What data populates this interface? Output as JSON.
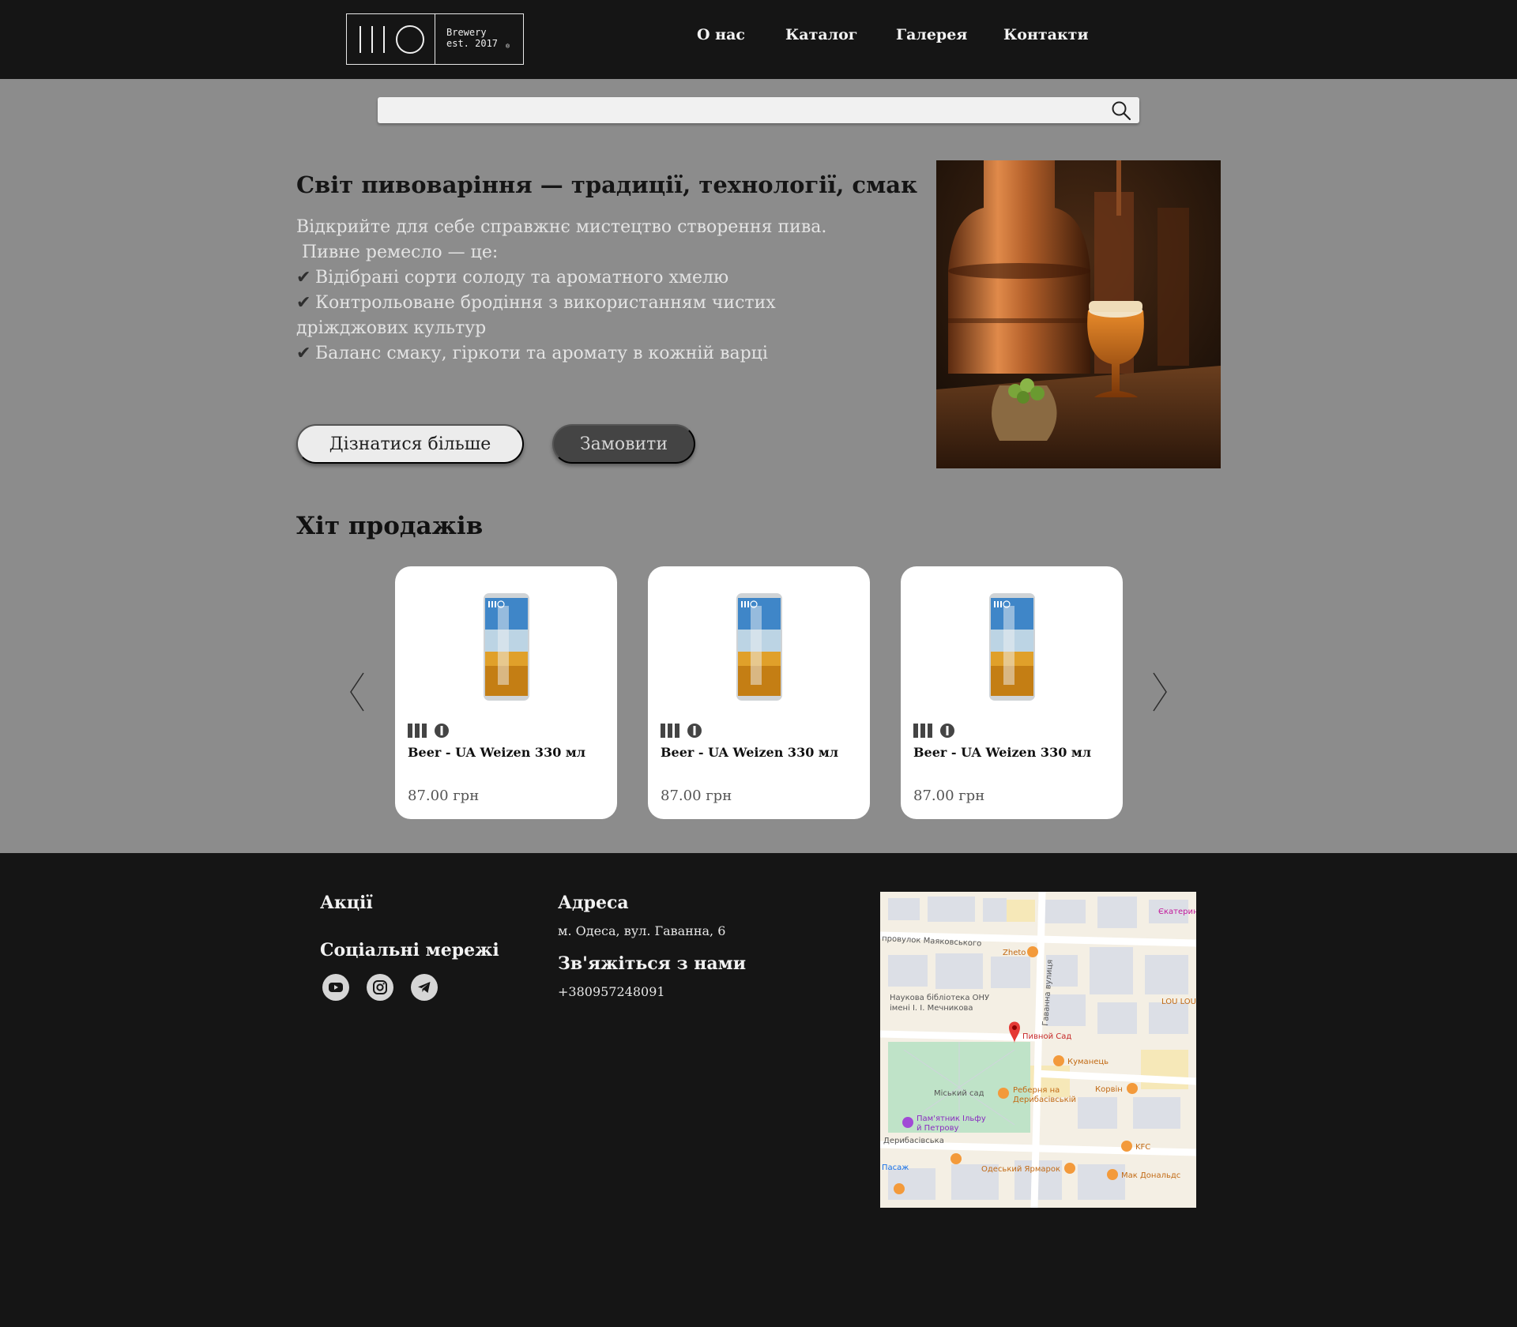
{
  "header": {
    "logo": {
      "line1": "Brewery",
      "line2": "est. 2017",
      "reg": "®"
    },
    "nav": [
      {
        "label": "О нас"
      },
      {
        "label": "Каталог"
      },
      {
        "label": "Галерея"
      },
      {
        "label": "Контакти"
      }
    ]
  },
  "search": {
    "value": "",
    "placeholder": "",
    "icon": "search-icon"
  },
  "hero": {
    "title": "Світ пивоваріння — традиції, технології, смак",
    "intro": "Відкрийте для себе справжнє мистецтво створення пива.",
    "subtitle": " Пивне ремесло — це:",
    "check_icon": "✔",
    "features": [
      "Відібрані сорти солоду та ароматного хмелю",
      "Контрольоване бродіння з використанням чистих дріжджових культур",
      "Баланс смаку, гіркоти та аромату в кожній варці"
    ],
    "btn_more": "Дізнатися більше",
    "btn_order": "Замовити"
  },
  "bestsellers": {
    "title": "Хіт продажів",
    "products": [
      {
        "name": "Beer - UA Weizen 330 мл",
        "price": "87.00 грн"
      },
      {
        "name": "Beer - UA Weizen 330 мл",
        "price": "87.00 грн"
      },
      {
        "name": "Beer - UA Weizen 330 мл",
        "price": "87.00 грн"
      }
    ]
  },
  "footer": {
    "promo": "Акції",
    "social_title": "Соціальні мережі",
    "social_icons": [
      "youtube-icon",
      "instagram-icon",
      "telegram-icon"
    ],
    "address_title": "Адреса",
    "address": "м. Одеса, вул. Гаванна, 6",
    "contact_title": "Зв'яжіться з нами",
    "phone": "+380957248091",
    "map": {
      "streets": [
        "провулок Маяковського",
        "Гаванна вулиця",
        "Дерибасівська",
        "Пасаж"
      ],
      "places": [
        "Zheto",
        "Наукова бібліотека ОНУ",
        "імені І. І. Мечникова",
        "Пивной Сад",
        "Куманець",
        "Міський сад",
        "Реберня на",
        "Дерибасівській",
        "Корвін",
        "Пам'ятник Ільфу",
        "й Петрову",
        "KFC",
        "Одеський Ярмарок",
        "Мак Дональдс",
        "LOU LOU",
        "Єкатерина"
      ]
    }
  }
}
